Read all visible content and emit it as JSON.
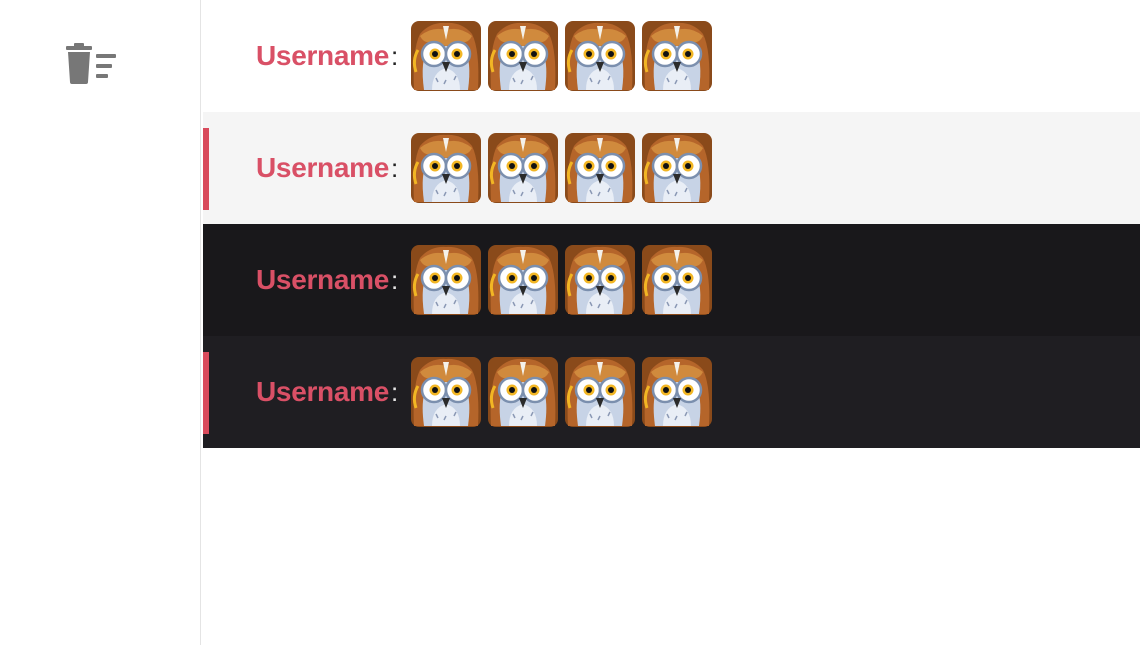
{
  "sidebar": {
    "clear_icon": "delete-sweep-icon"
  },
  "colors": {
    "username": "#d95066",
    "accent_bar": "#d94b5c",
    "light_bg": "#ffffff",
    "light_alt_bg": "#f5f5f5",
    "dark_bg": "#19181b",
    "dark_alt_bg": "#1f1e22"
  },
  "messages": [
    {
      "username": "Username",
      "separator": ":",
      "emote_icon": "owl-emote-icon",
      "emote_count": 4,
      "theme": "light",
      "highlighted": false
    },
    {
      "username": "Username",
      "separator": ":",
      "emote_icon": "owl-emote-icon",
      "emote_count": 4,
      "theme": "light",
      "highlighted": true
    },
    {
      "username": "Username",
      "separator": ":",
      "emote_icon": "owl-emote-icon",
      "emote_count": 4,
      "theme": "dark",
      "highlighted": false
    },
    {
      "username": "Username",
      "separator": ":",
      "emote_icon": "owl-emote-icon",
      "emote_count": 4,
      "theme": "dark",
      "highlighted": true
    }
  ]
}
